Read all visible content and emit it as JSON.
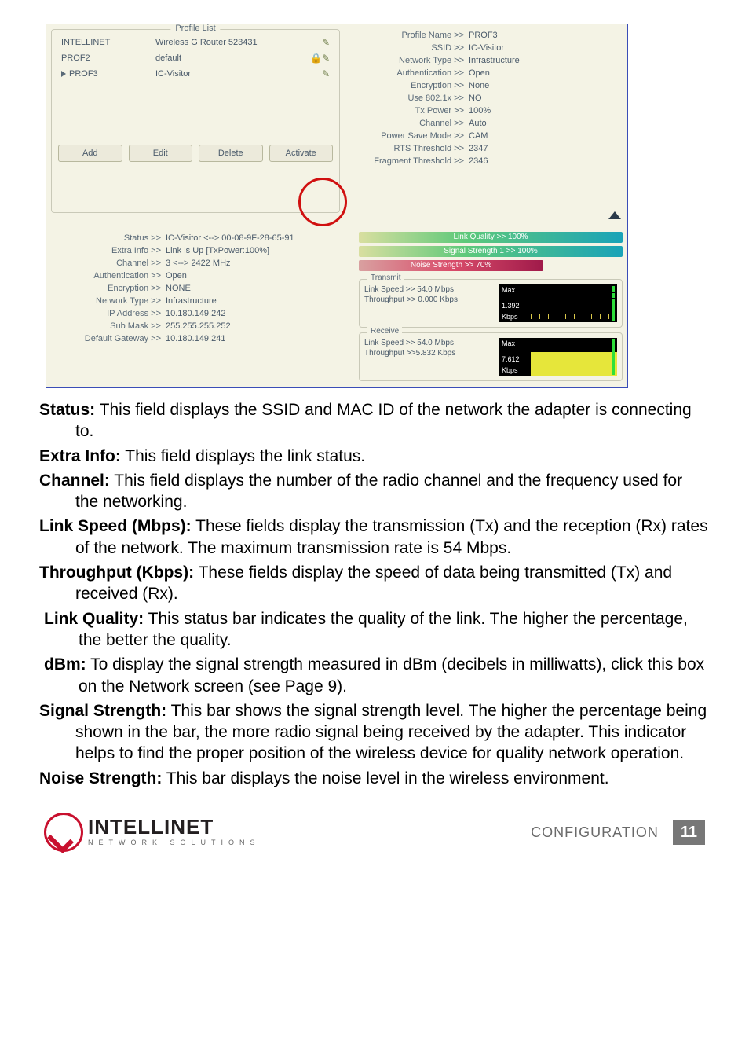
{
  "profile_list": {
    "legend": "Profile List",
    "rows": [
      {
        "name": "INTELLINET",
        "desc": "Wireless G Router 523431",
        "icon": "✎",
        "selected": false
      },
      {
        "name": "PROF2",
        "desc": "default",
        "icon": "🔒✎",
        "selected": false
      },
      {
        "name": "PROF3",
        "desc": "IC-Visitor",
        "icon": "✎",
        "selected": true
      }
    ],
    "buttons": {
      "add": "Add",
      "edit": "Edit",
      "delete": "Delete",
      "activate": "Activate"
    }
  },
  "detail": {
    "profile_name": {
      "k": "Profile Name >>",
      "v": "PROF3"
    },
    "ssid": {
      "k": "SSID >>",
      "v": "IC-Visitor"
    },
    "network_type": {
      "k": "Network Type >>",
      "v": "Infrastructure"
    },
    "auth": {
      "k": "Authentication >>",
      "v": "Open"
    },
    "enc": {
      "k": "Encryption >>",
      "v": "None"
    },
    "use8021x": {
      "k": "Use 802.1x >>",
      "v": "NO"
    },
    "txpower": {
      "k": "Tx Power >>",
      "v": "100%"
    },
    "channel": {
      "k": "Channel >>",
      "v": "Auto"
    },
    "psm": {
      "k": "Power Save Mode >>",
      "v": "CAM"
    },
    "rts": {
      "k": "RTS Threshold >>",
      "v": "2347"
    },
    "frag": {
      "k": "Fragment Threshold >>",
      "v": "2346"
    }
  },
  "status_block": {
    "status": {
      "k": "Status >>",
      "v": "IC-Visitor <--> 00-08-9F-28-65-91"
    },
    "extra": {
      "k": "Extra Info >>",
      "v": "Link is Up [TxPower:100%]"
    },
    "channel": {
      "k": "Channel >>",
      "v": "3 <--> 2422 MHz"
    },
    "auth": {
      "k": "Authentication >>",
      "v": "Open"
    },
    "enc": {
      "k": "Encryption >>",
      "v": "NONE"
    },
    "nt": {
      "k": "Network Type >>",
      "v": "Infrastructure"
    },
    "ip": {
      "k": "IP Address >>",
      "v": "10.180.149.242"
    },
    "mask": {
      "k": "Sub Mask >>",
      "v": "255.255.255.252"
    },
    "gw": {
      "k": "Default Gateway >>",
      "v": "10.180.149.241"
    }
  },
  "bars": {
    "lq": "Link Quality >> 100%",
    "ss": "Signal Strength 1 >> 100%",
    "ns": "Noise Strength >> 70%"
  },
  "transmit": {
    "legend": "Transmit",
    "ls": "Link Speed >> 54.0 Mbps",
    "tp": "Throughput >> 0.000 Kbps",
    "max": "Max",
    "mid": "1.392",
    "unit": "Kbps"
  },
  "receive": {
    "legend": "Receive",
    "ls": "Link Speed >> 54.0 Mbps",
    "tp": "Throughput >>5.832 Kbps",
    "max": "Max",
    "mid": "7.612",
    "unit": "Kbps"
  },
  "defs": {
    "status_b": "Status:",
    "status_t": " This field displays the SSID and MAC ID of the network the adapter is connecting to.",
    "extra_b": "Extra Info:",
    "extra_t": " This field displays the link status.",
    "channel_b": "Channel:",
    "channel_t": " This field displays the number of the radio channel and the frequency used for the networking.",
    "ls_b": "Link Speed (Mbps):",
    "ls_t": " These fields display the transmission (Tx) and the reception (Rx) rates of the network. The maximum transmission rate is 54 Mbps.",
    "tp_b": "Throughput (Kbps):",
    "tp_t": " These fields display the speed of data being transmitted (Tx) and received (Rx).",
    "lq_b": "Link Quality:",
    "lq_t": " This status bar indicates the quality of the link. The higher the percentage, the better the quality.",
    "dbm_b": "dBm:",
    "dbm_t": "  To display the signal strength measured in dBm (decibels in milliwatts), click this box on the Network screen (see Page 9).",
    "ss_b": "Signal Strength:",
    "ss_t": " This bar shows the signal strength level. The higher the percentage being shown in the bar, the more radio signal being received by the adapter. This indicator helps to find the proper position of the wireless device for quality network operation.",
    "ns_b": "Noise Strength:",
    "ns_t": " This bar displays the noise level in the wireless environment."
  },
  "footer": {
    "brand": "INTELLINET",
    "sub": "NETWORK SOLUTIONS",
    "section": "CONFIGURATION",
    "page": "11"
  }
}
